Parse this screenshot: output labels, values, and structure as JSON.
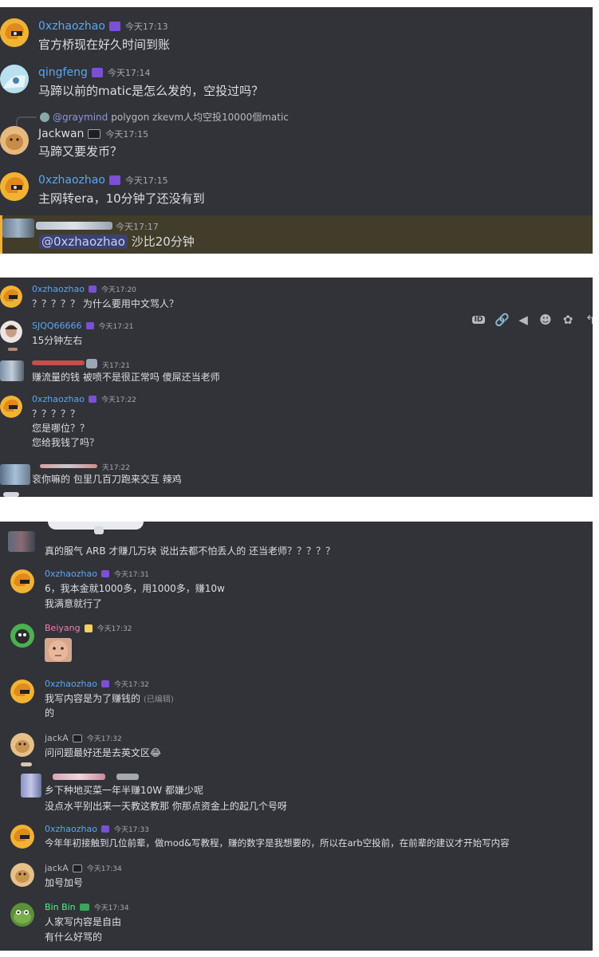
{
  "panel1": {
    "m1": {
      "name": "0xzhaozhao",
      "time": "今天17:13",
      "text": "官方桥现在好久时间到账"
    },
    "m2": {
      "name": "qingfeng",
      "time": "今天17:14",
      "text": "马蹄以前的matic是怎么发的，空投过吗？"
    },
    "m3": {
      "reply_name": "@graymind",
      "reply_text": "polygon zkevm人均空投10000個matic",
      "name": "Jackwan",
      "time": "今天17:15",
      "text": "马蹄又要发币？"
    },
    "m4": {
      "name": "0xzhaozhao",
      "time": "今天17:15",
      "text": "主网转era，10分钟了还没有到"
    },
    "m5": {
      "time": "今天17:17",
      "mention": "@0xzhaozhao",
      "text": "沙比20分钟"
    }
  },
  "panel2": {
    "m1": {
      "name": "0xzhaozhao",
      "time": "今天17:20",
      "text": "？？？？？ 为什么要用中文骂人？"
    },
    "m2": {
      "name": "SJQQ66666",
      "time": "今天17:21",
      "text": "15分钟左右"
    },
    "m3": {
      "time": "天17:21",
      "text": "赚流量的钱 被喷不是很正常吗 傻屌还当老师"
    },
    "m4": {
      "name": "0xzhaozhao",
      "time": "今天17:22",
      "lines": [
        "？？？？？",
        "您是哪位？？",
        "您给我钱了吗？"
      ]
    },
    "m5": {
      "time": "天17:22",
      "text": "衮你嘛的 包里几百刀跑来交互 辣鸡"
    },
    "toolbar": {
      "icons": [
        "ID",
        "🔗",
        "◀",
        "☻",
        "✿",
        "↰",
        "⋮"
      ]
    }
  },
  "panel3": {
    "m0": {
      "text": "真的服气 ARB 才赚几万块 说出去都不怕丢人的 还当老师？？？？？"
    },
    "m1": {
      "name": "0xzhaozhao",
      "time": "今天17:31",
      "lines": [
        "6，我本金就1000多，用1000多，赚10w",
        "我满意就行了"
      ]
    },
    "m2": {
      "name": "Beiyang",
      "time": "今天17:32"
    },
    "m3": {
      "name": "0xzhaozhao",
      "time": "今天17:32",
      "lines": [
        "我写内容是为了赚钱的",
        "的"
      ],
      "edited": "(已编辑)"
    },
    "m4": {
      "name": "jackA",
      "time": "今天17:32",
      "text": "问问题最好还是去英文区😂"
    },
    "m5": {
      "lines": [
        "乡下种地买菜一年半赚10W 都嫌少呢",
        "没点水平别出来一天教这教那 你那点资金上的起几个号呀"
      ]
    },
    "m6": {
      "name": "0xzhaozhao",
      "time": "今天17:33",
      "text": "今年年初接触到几位前辈，做mod&写教程，赚的数字是我想要的，所以在arb空投前，在前辈的建议才开始写内容"
    },
    "m7": {
      "name": "jackA",
      "time": "今天17:34",
      "text": "加号加号"
    },
    "m8": {
      "name": "Bin Bin",
      "time": "今天17:34",
      "lines": [
        "人家写内容是自由",
        "有什么好骂的"
      ]
    }
  },
  "colors": {
    "bg": "#313338",
    "name_blue": "#5ba6f2",
    "name_pink": "#f47fa8",
    "name_green": "#57f287",
    "text": "#dbdee1",
    "timestamp": "#a5a8ad"
  }
}
